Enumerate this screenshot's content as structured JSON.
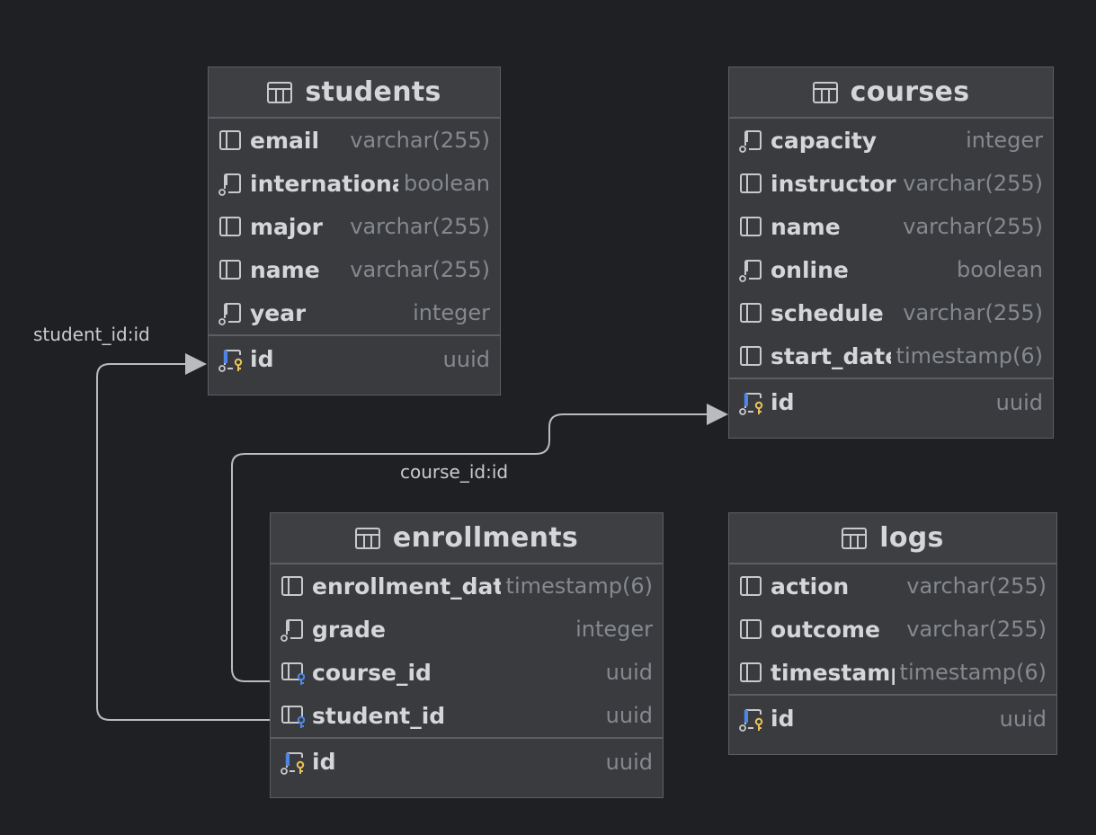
{
  "relations": [
    {
      "label": "student_id:id",
      "from": "enrollments.student_id",
      "to": "students.id"
    },
    {
      "label": "course_id:id",
      "from": "enrollments.course_id",
      "to": "courses.id"
    }
  ],
  "entities": {
    "students": {
      "title": "students",
      "columns": [
        {
          "name": "email",
          "type": "varchar(255)",
          "icon": "column-icon"
        },
        {
          "name": "international",
          "type": "boolean",
          "icon": "nullable-column-icon"
        },
        {
          "name": "major",
          "type": "varchar(255)",
          "icon": "column-icon"
        },
        {
          "name": "name",
          "type": "varchar(255)",
          "icon": "column-icon"
        },
        {
          "name": "year",
          "type": "integer",
          "icon": "nullable-column-icon"
        }
      ],
      "pk": {
        "name": "id",
        "type": "uuid",
        "icon": "primary-key-icon"
      }
    },
    "courses": {
      "title": "courses",
      "columns": [
        {
          "name": "capacity",
          "type": "integer",
          "icon": "nullable-column-icon"
        },
        {
          "name": "instructor",
          "type": "varchar(255)",
          "icon": "column-icon"
        },
        {
          "name": "name",
          "type": "varchar(255)",
          "icon": "column-icon"
        },
        {
          "name": "online",
          "type": "boolean",
          "icon": "nullable-column-icon"
        },
        {
          "name": "schedule",
          "type": "varchar(255)",
          "icon": "column-icon"
        },
        {
          "name": "start_date",
          "type": "timestamp(6)",
          "icon": "column-icon"
        }
      ],
      "pk": {
        "name": "id",
        "type": "uuid",
        "icon": "primary-key-icon"
      }
    },
    "enrollments": {
      "title": "enrollments",
      "columns": [
        {
          "name": "enrollment_date",
          "type": "timestamp(6)",
          "icon": "column-icon"
        },
        {
          "name": "grade",
          "type": "integer",
          "icon": "nullable-column-icon"
        },
        {
          "name": "course_id",
          "type": "uuid",
          "icon": "foreign-key-icon"
        },
        {
          "name": "student_id",
          "type": "uuid",
          "icon": "foreign-key-icon"
        }
      ],
      "pk": {
        "name": "id",
        "type": "uuid",
        "icon": "primary-key-icon"
      }
    },
    "logs": {
      "title": "logs",
      "columns": [
        {
          "name": "action",
          "type": "varchar(255)",
          "icon": "column-icon"
        },
        {
          "name": "outcome",
          "type": "varchar(255)",
          "icon": "column-icon"
        },
        {
          "name": "timestamp",
          "type": "timestamp(6)",
          "icon": "column-icon"
        }
      ],
      "pk": {
        "name": "id",
        "type": "uuid",
        "icon": "primary-key-icon"
      }
    }
  },
  "colors": {
    "background": "#1f2023",
    "pk_key": "#e8c25a",
    "fk_key": "#4f86e6",
    "connector": "#b9bbbf"
  }
}
